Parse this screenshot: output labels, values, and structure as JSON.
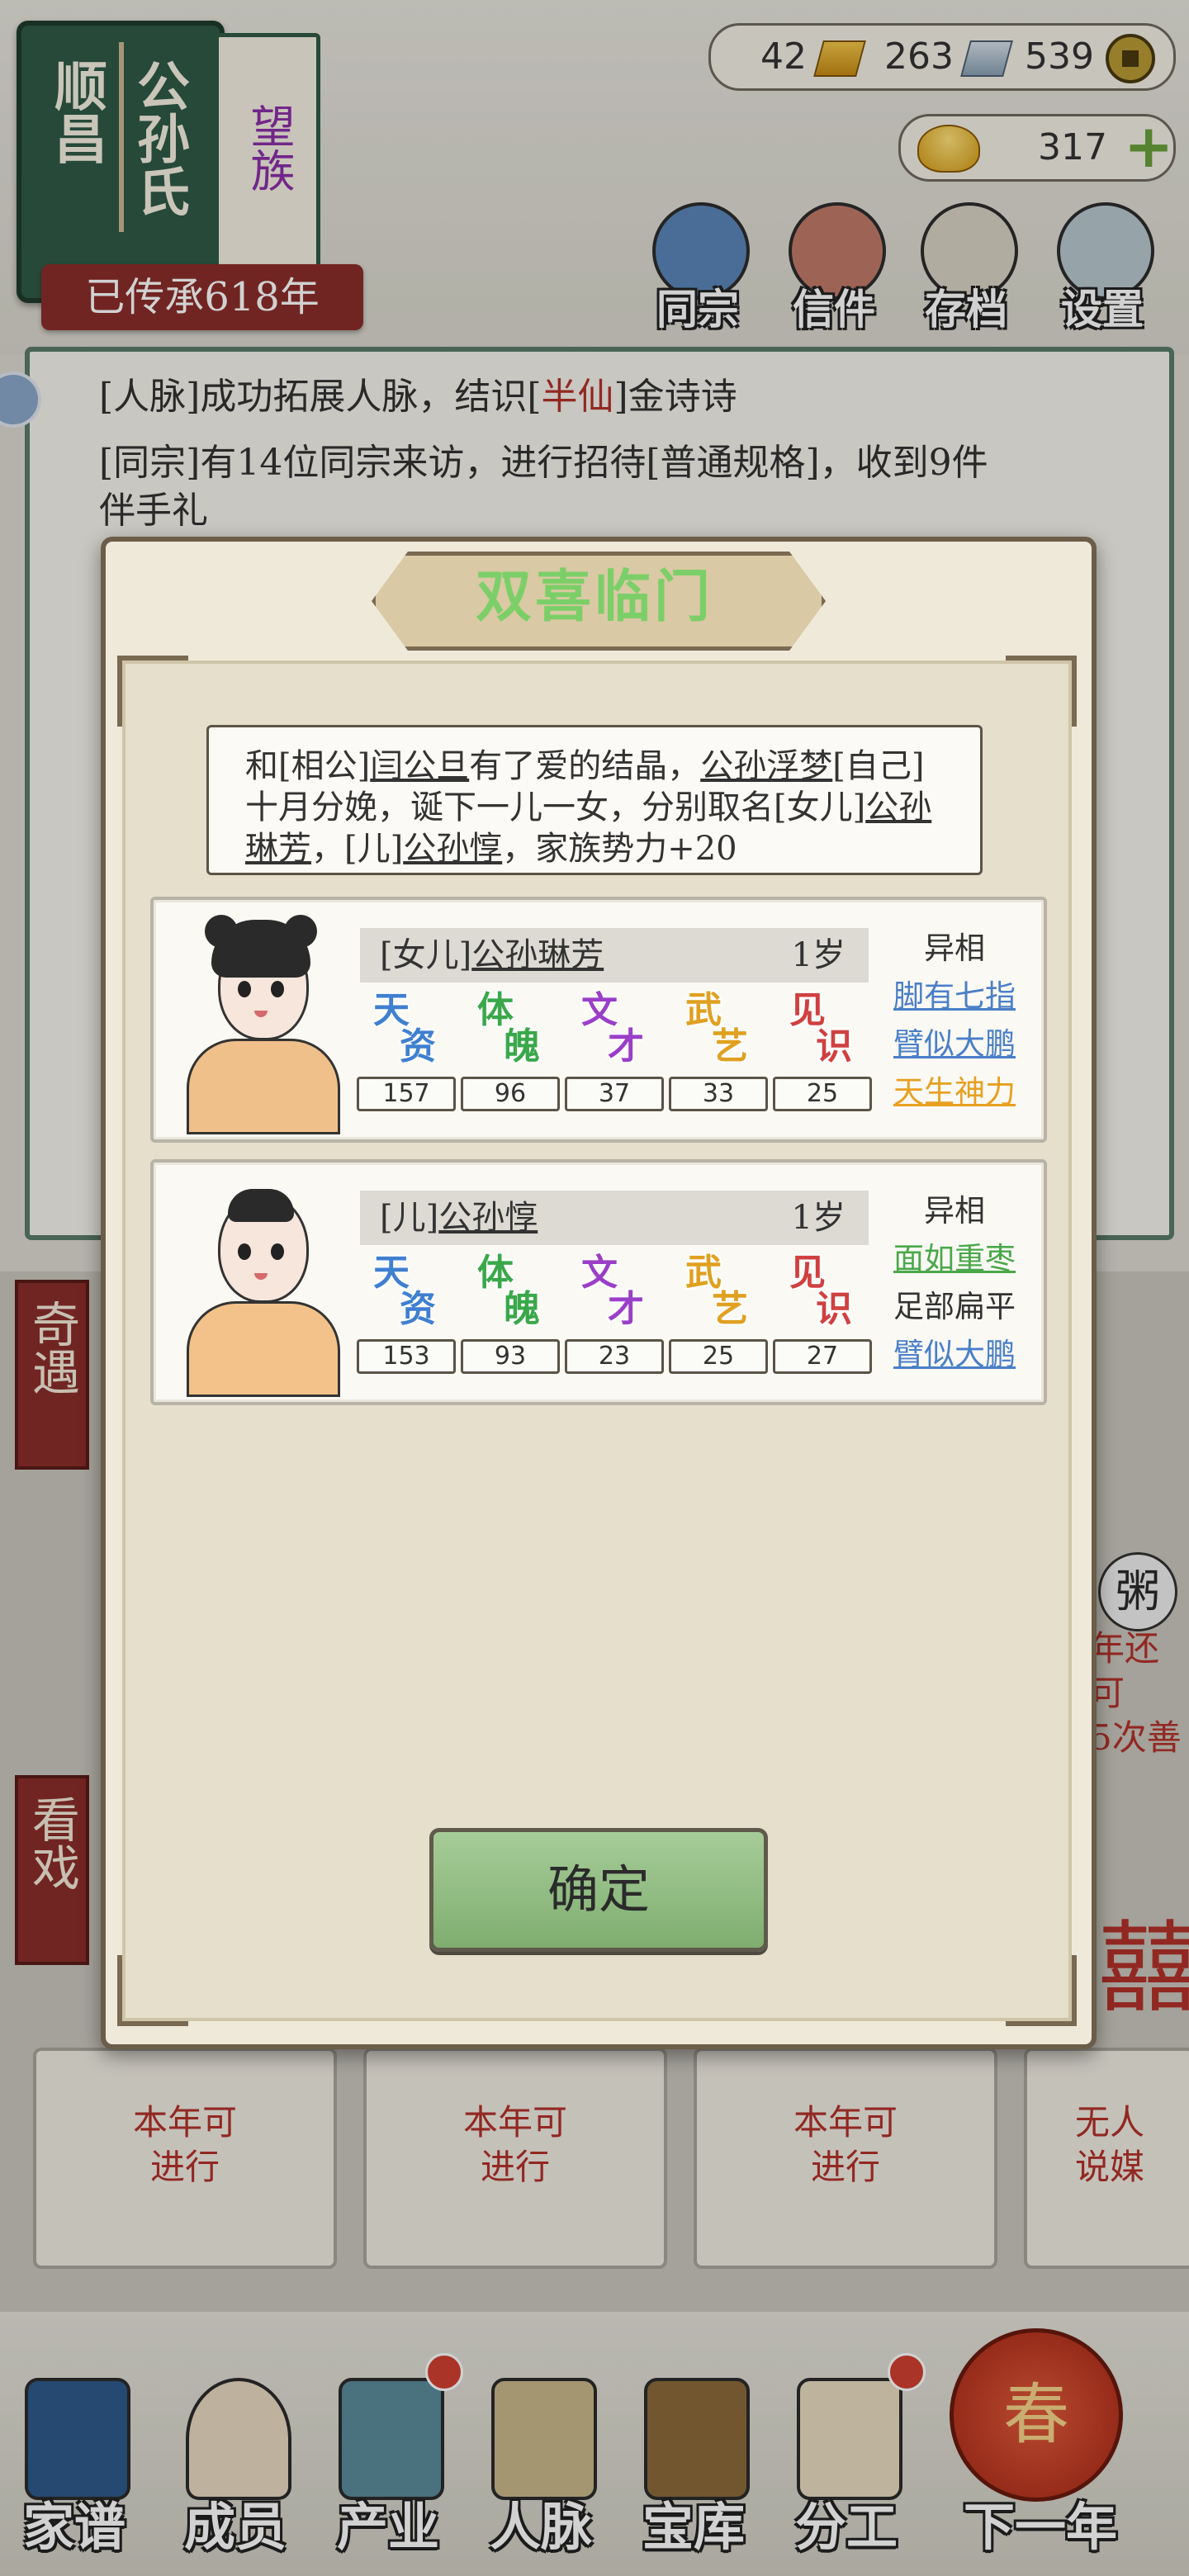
{
  "clan": {
    "lineage_left": "顺昌",
    "lineage_right": "公孙氏",
    "rank": "望族",
    "heritage": "已传承618年"
  },
  "resources": {
    "gold_bar": "42",
    "silver_bar": "263",
    "coin": "539",
    "ingot": "317"
  },
  "top_nav": [
    "同宗",
    "信件",
    "存档",
    "设置"
  ],
  "log": {
    "line1_prefix": "[人脉]成功拓展人脉，结识[",
    "line1_highlight": "半仙",
    "line1_suffix": "]金诗诗",
    "line2": "[同宗]有14位同宗来访，进行招待[普通规格]，收到9件",
    "line3": "伴手礼"
  },
  "background": {
    "side_tab_1": "奇遇",
    "side_tab_2": "看戏",
    "porridge": "粥",
    "right_card_1": "年还可",
    "right_card_2": "5次善",
    "card_1": "本年可\n进行",
    "card_2": "本年可\n进行",
    "card_3": "本年可\n进行",
    "card_4_l1": "无人",
    "card_4_l2": "说媒",
    "xi": "囍"
  },
  "modal": {
    "title": "双喜临门",
    "desc": {
      "t1": "和[相公]",
      "spouse": "闫公旦",
      "t2": "有了爱的结晶，",
      "self": "公孙浮梦",
      "t3": "[自己]十月分娩，诞下一儿一女，分别取名[女儿]",
      "daughter": "公孙琳芳",
      "t4": "，[儿]",
      "son": "公孙惇",
      "t5": "，家族势力+20"
    },
    "stat_labels": [
      {
        "a": "天",
        "b": "资"
      },
      {
        "a": "体",
        "b": "魄"
      },
      {
        "a": "文",
        "b": "才"
      },
      {
        "a": "武",
        "b": "艺"
      },
      {
        "a": "见",
        "b": "识"
      }
    ],
    "children": [
      {
        "relation": "[女儿]",
        "name": "公孙琳芳",
        "age": "1岁",
        "stats": [
          "157",
          "96",
          "37",
          "33",
          "25"
        ],
        "traits_header": "异相",
        "traits": [
          {
            "text": "脚有七指",
            "color": "#4a7fc8"
          },
          {
            "text": "臂似大鹏",
            "color": "#4a7fc8"
          },
          {
            "text": "天生神力",
            "color": "#e8a020"
          }
        ]
      },
      {
        "relation": "[儿]",
        "name": "公孙惇",
        "age": "1岁",
        "stats": [
          "153",
          "93",
          "23",
          "25",
          "27"
        ],
        "traits_header": "异相",
        "traits": [
          {
            "text": "面如重枣",
            "color": "#4aa84a"
          },
          {
            "text": "足部扁平",
            "color": "#333333"
          },
          {
            "text": "臂似大鹏",
            "color": "#4a7fc8"
          }
        ]
      }
    ],
    "confirm": "确定"
  },
  "bottom_nav": [
    "家谱",
    "成员",
    "产业",
    "人脉",
    "宝库",
    "分工",
    "下一年"
  ],
  "lantern": "春",
  "colors": {
    "stat_tian": "#3f7fd0",
    "stat_ti": "#3aa84a",
    "stat_wen": "#9a3fc8",
    "stat_wu": "#e0a020",
    "stat_jian": "#d04040"
  }
}
